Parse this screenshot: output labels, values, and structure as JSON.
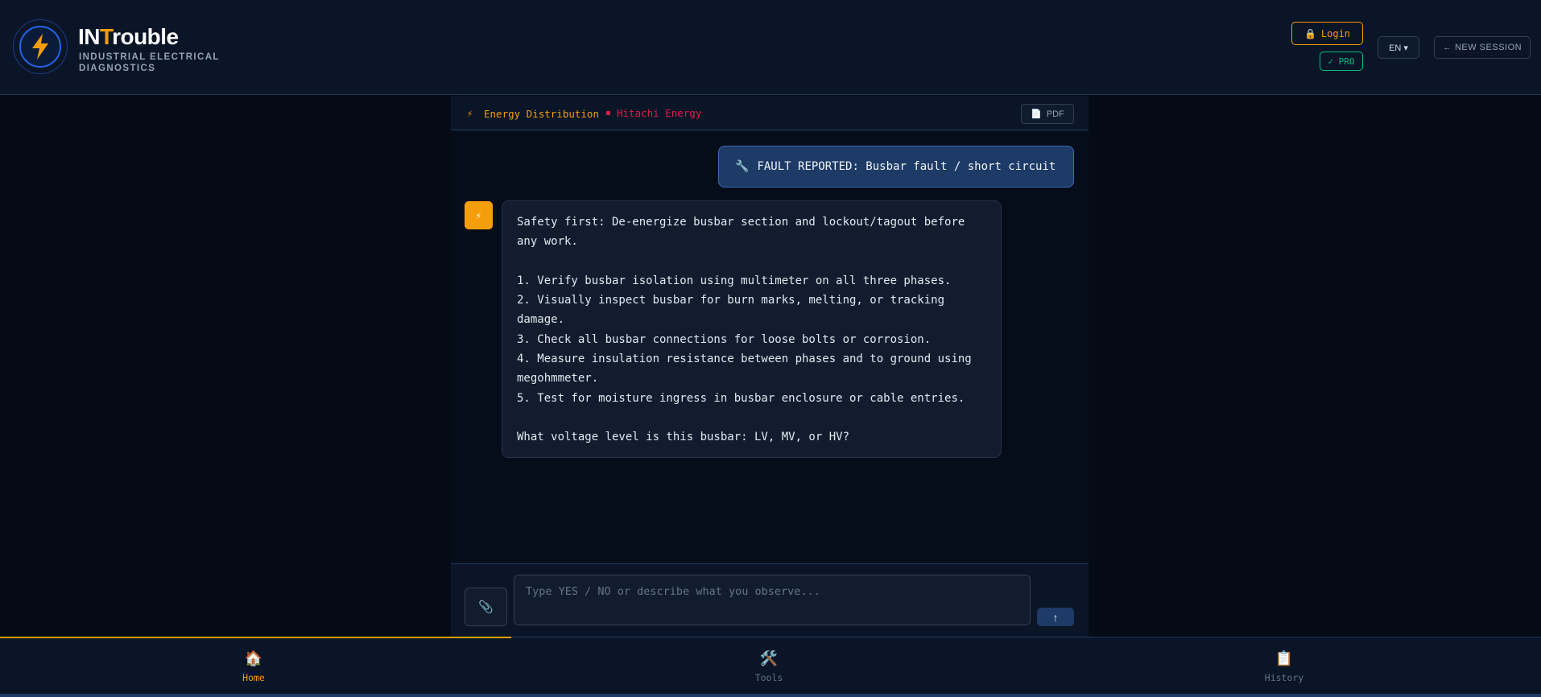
{
  "app": {
    "brand_prefix": "IN",
    "brand_highlight": "T",
    "brand_suffix": "rouble",
    "subtitle": "INDUSTRIAL ELECTRICAL DIAGNOSTICS"
  },
  "header": {
    "login_label": "Login",
    "pro_badge": "✓ PRO",
    "language": "EN ▾",
    "new_session": "← NEW SESSION"
  },
  "context": {
    "category": "Energy Distribution",
    "manufacturer": "Hitachi Energy",
    "pdf_label": "PDF"
  },
  "messages": {
    "user": "FAULT REPORTED: Busbar fault / short circuit",
    "bot": "Safety first: De-energize busbar section and lockout/tagout before any work.\n\n1. Verify busbar isolation using multimeter on all three phases.\n2. Visually inspect busbar for burn marks, melting, or tracking damage.\n3. Check all busbar connections for loose bolts or corrosion.\n4. Measure insulation resistance between phases and to ground using megohmmeter.\n5. Test for moisture ingress in busbar enclosure or cable entries.\n\nWhat voltage level is this busbar: LV, MV, or HV?"
  },
  "composer": {
    "placeholder": "Type YES / NO or describe what you observe...",
    "value": ""
  },
  "nav": {
    "items": [
      {
        "label": "Home",
        "icon": "home-icon",
        "active": true
      },
      {
        "label": "Tools",
        "icon": "tools-icon",
        "active": false
      },
      {
        "label": "History",
        "icon": "clipboard-icon",
        "active": false
      }
    ]
  },
  "colors": {
    "accent": "#f59e0b",
    "brand_manufacturer": "#e11d48",
    "pro": "#10b981",
    "background": "#050b15",
    "user_bubble": "#1e3a66"
  }
}
